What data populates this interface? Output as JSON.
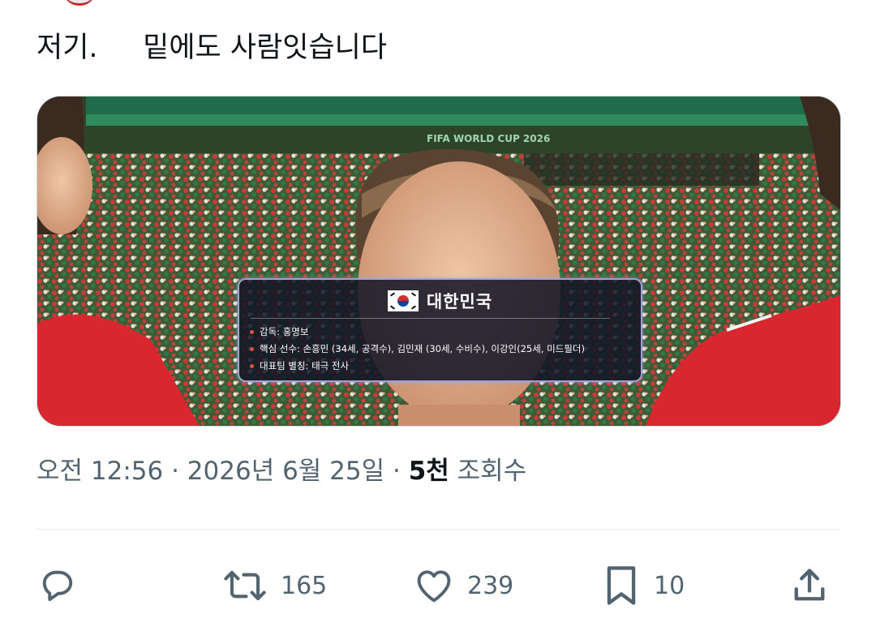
{
  "tweet": {
    "text": "저기.     밑에도 사람잇습니다"
  },
  "media": {
    "stadium_banner": "FIFA WORLD CUP 2026",
    "overlay": {
      "title": "대한민국",
      "flag_icon": "south-korea-flag",
      "items": [
        "감독: 홍명보",
        "핵심 선수: 손흥민 (34세, 공격수), 김민재 (30세, 수비수), 이강인(25세, 미드필더)",
        "대표팀 별칭: 태극 전사"
      ]
    }
  },
  "meta": {
    "time": "오전 12:56",
    "separator": " · ",
    "date": "2026년 6월 25일",
    "views_count": "5천",
    "views_label": "조회수"
  },
  "actions": {
    "reply": {
      "icon": "reply-icon",
      "count": ""
    },
    "retweet": {
      "icon": "retweet-icon",
      "count": "165"
    },
    "like": {
      "icon": "heart-icon",
      "count": "239"
    },
    "bookmark": {
      "icon": "bookmark-icon",
      "count": "10"
    },
    "share": {
      "icon": "share-icon",
      "count": ""
    }
  },
  "colors": {
    "text": "#0f1419",
    "secondary": "#536471",
    "divider": "#e6ecf0",
    "jersey_red": "#d8272f"
  }
}
